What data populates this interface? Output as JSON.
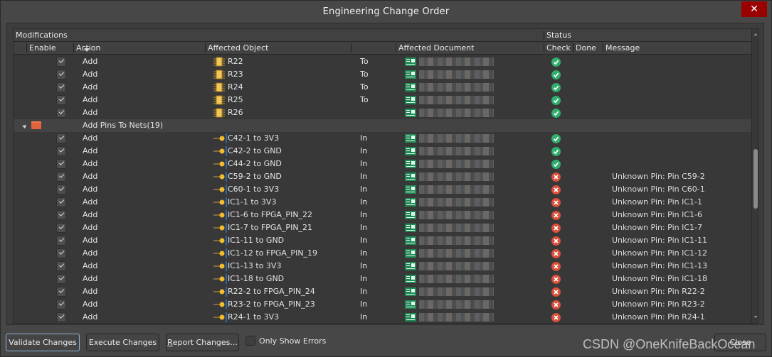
{
  "window": {
    "title": "Engineering Change Order",
    "close_icon": "close-x-icon"
  },
  "grid": {
    "group_headers": {
      "modifications": "Modifications",
      "status": "Status"
    },
    "columns": {
      "enable": "Enable",
      "action": "Action",
      "affected_object": "Affected Object",
      "affected_document": "Affected Document",
      "check": "Check",
      "done": "Done",
      "message": "Message"
    },
    "rows_before_group": [
      {
        "enabled": true,
        "action": "Add",
        "object": "R22",
        "object_icon": "component-icon",
        "prep": "To",
        "check": "ok",
        "message": ""
      },
      {
        "enabled": true,
        "action": "Add",
        "object": "R23",
        "object_icon": "component-icon",
        "prep": "To",
        "check": "ok",
        "message": ""
      },
      {
        "enabled": true,
        "action": "Add",
        "object": "R24",
        "object_icon": "component-icon",
        "prep": "To",
        "check": "ok",
        "message": ""
      },
      {
        "enabled": true,
        "action": "Add",
        "object": "R25",
        "object_icon": "component-icon",
        "prep": "To",
        "check": "ok",
        "message": ""
      },
      {
        "enabled": true,
        "action": "Add",
        "object": "R26",
        "object_icon": "component-icon",
        "prep": "",
        "check": "ok",
        "message": ""
      }
    ],
    "group": {
      "label": "Add Pins To Nets(19)",
      "expanded": true,
      "icon": "folder-icon"
    },
    "rows_after_group": [
      {
        "enabled": true,
        "action": "Add",
        "object": "C42-1 to 3V3",
        "prep": "In",
        "check": "ok",
        "message": ""
      },
      {
        "enabled": true,
        "action": "Add",
        "object": "C42-2 to GND",
        "prep": "In",
        "check": "ok",
        "message": ""
      },
      {
        "enabled": true,
        "action": "Add",
        "object": "C44-2 to GND",
        "prep": "In",
        "check": "ok",
        "message": ""
      },
      {
        "enabled": true,
        "action": "Add",
        "object": "C59-2 to GND",
        "prep": "In",
        "check": "err",
        "message": "Unknown Pin: Pin C59-2"
      },
      {
        "enabled": true,
        "action": "Add",
        "object": "C60-1 to 3V3",
        "prep": "In",
        "check": "err",
        "message": "Unknown Pin: Pin C60-1"
      },
      {
        "enabled": true,
        "action": "Add",
        "object": "IC1-1 to 3V3",
        "prep": "In",
        "check": "err",
        "message": "Unknown Pin: Pin IC1-1"
      },
      {
        "enabled": true,
        "action": "Add",
        "object": "IC1-6 to FPGA_PIN_22",
        "prep": "In",
        "check": "err",
        "message": "Unknown Pin: Pin IC1-6"
      },
      {
        "enabled": true,
        "action": "Add",
        "object": "IC1-7 to FPGA_PIN_21",
        "prep": "In",
        "check": "err",
        "message": "Unknown Pin: Pin IC1-7"
      },
      {
        "enabled": true,
        "action": "Add",
        "object": "IC1-11 to GND",
        "prep": "In",
        "check": "err",
        "message": "Unknown Pin: Pin IC1-11"
      },
      {
        "enabled": true,
        "action": "Add",
        "object": "IC1-12 to FPGA_PIN_19",
        "prep": "In",
        "check": "err",
        "message": "Unknown Pin: Pin IC1-12"
      },
      {
        "enabled": true,
        "action": "Add",
        "object": "IC1-13 to 3V3",
        "prep": "In",
        "check": "err",
        "message": "Unknown Pin: Pin IC1-13"
      },
      {
        "enabled": true,
        "action": "Add",
        "object": "IC1-18 to GND",
        "prep": "In",
        "check": "err",
        "message": "Unknown Pin: Pin IC1-18"
      },
      {
        "enabled": true,
        "action": "Add",
        "object": "R22-2 to FPGA_PIN_24",
        "prep": "In",
        "check": "err",
        "message": "Unknown Pin: Pin R22-2"
      },
      {
        "enabled": true,
        "action": "Add",
        "object": "R23-2 to FPGA_PIN_23",
        "prep": "In",
        "check": "err",
        "message": "Unknown Pin: Pin R23-2"
      },
      {
        "enabled": true,
        "action": "Add",
        "object": "R24-1 to 3V3",
        "prep": "In",
        "check": "err",
        "message": "Unknown Pin: Pin R24-1"
      }
    ]
  },
  "footer": {
    "validate_label": "Validate Changes",
    "execute_label": "Execute Changes",
    "report_label_mnemonic": "R",
    "report_label_rest": "eport Changes...",
    "only_errors_label": "Only Show Errors",
    "only_errors_checked": false,
    "close_label": "Close"
  },
  "watermark": "CSDN @OneKnifeBackOcean",
  "colors": {
    "ok": "#2fae6c",
    "error": "#d9503c",
    "close_button": "#9b0000",
    "focus_border": "#8bb4d9"
  }
}
